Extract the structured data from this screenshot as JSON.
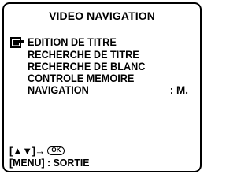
{
  "screen": {
    "title": "VIDEO NAVIGATION"
  },
  "menu": {
    "items": [
      {
        "label": "EDITION DE TITRE",
        "selected": true
      },
      {
        "label": "RECHERCHE DE TITRE"
      },
      {
        "label": "RECHERCHE DE BLANC"
      },
      {
        "label": "CONTROLE MEMOIRE"
      },
      {
        "label": "NAVIGATION",
        "value": ": M."
      }
    ]
  },
  "footer": {
    "nav_keys": "[▲▼]",
    "arrow": "→",
    "ok_label": "OK",
    "exit_hint": "[MENU] : SORTIE"
  },
  "icons": {
    "cursor": "pointing-hand-icon",
    "ok": "ok-button-icon"
  }
}
